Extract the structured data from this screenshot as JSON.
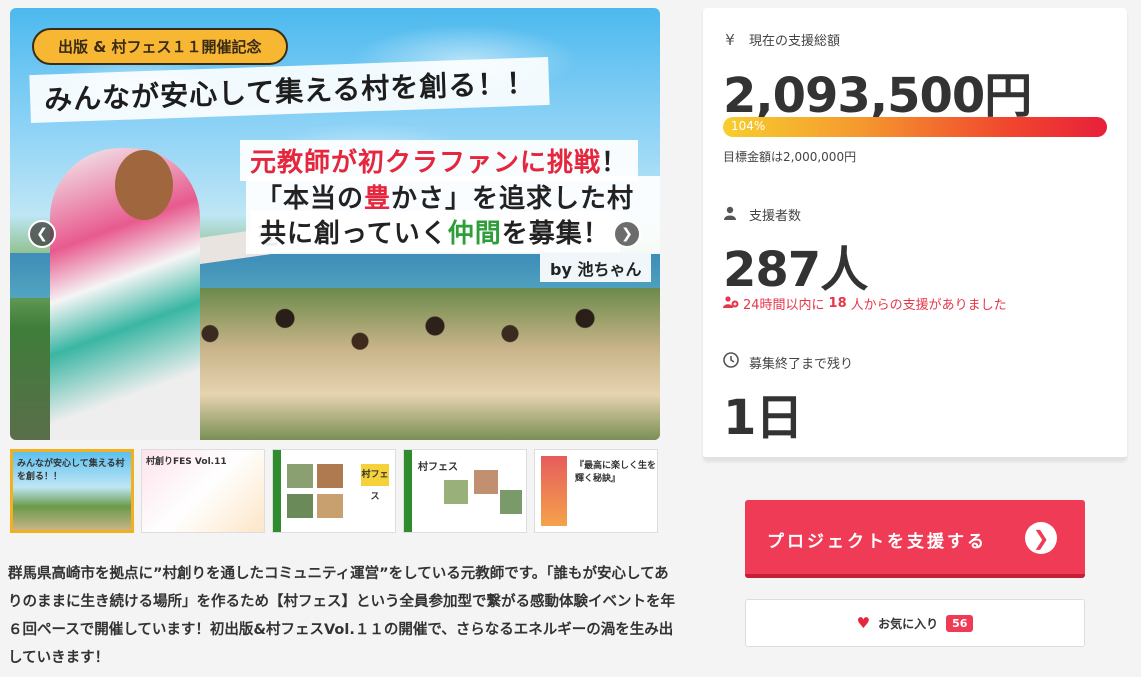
{
  "hero": {
    "banner": "出版 & 村フェス１１開催記念",
    "headline": "みんなが安心して集える村を創る！！",
    "line1_a": "元教師が初クラファンに",
    "line1_b": "挑戦",
    "line1_c": "！",
    "line2_a": "「本当の",
    "line2_b": "豊",
    "line2_c": "かさ」を追求した村を",
    "line3_a": "共に創っていく",
    "line3_b": "仲間",
    "line3_c": "を募集！",
    "byline": "by 池ちゃん",
    "prev_icon": "chevron-left-icon",
    "next_icon": "chevron-right-icon"
  },
  "thumbnails": [
    {
      "label": "みんなが安心して集える村を創る！！",
      "active": true
    },
    {
      "label": "村創りFES Vol.11",
      "active": false
    },
    {
      "label": "村フェス",
      "active": false
    },
    {
      "label": "村フェス",
      "active": false
    },
    {
      "label": "『最高に楽しく生を輝く秘訣』",
      "active": false
    }
  ],
  "description": "群馬県高崎市を拠点に”村創りを通したコミュニティ運営”をしている元教師です。「誰もが安心してありのままに生き続ける場所」を作るため【村フェス】という全員参加型で繋がる感動体験イベントを年６回ペースで開催しています！初出版&村フェスVol.１１の開催で、さらなるエネルギーの渦を生み出していきます！",
  "stats": {
    "total_label": "現在の支援総額",
    "total_value": "2,093,500円",
    "progress_label": "104%",
    "progress_percent": 104,
    "goal": "目標金額は2,000,000円",
    "backers_label": "支援者数",
    "backers_value": "287人",
    "recent_prefix": "24時間以内に",
    "recent_count": "18",
    "recent_suffix": "人からの支援がありました",
    "remaining_label": "募集終了まで残り",
    "remaining_value": "1日",
    "colors": {
      "accent": "#ef3b55",
      "alert": "#e6374a"
    }
  },
  "actions": {
    "support_label": "プロジェクトを支援する",
    "favorite_label": "お気に入り",
    "favorite_count": "56"
  }
}
